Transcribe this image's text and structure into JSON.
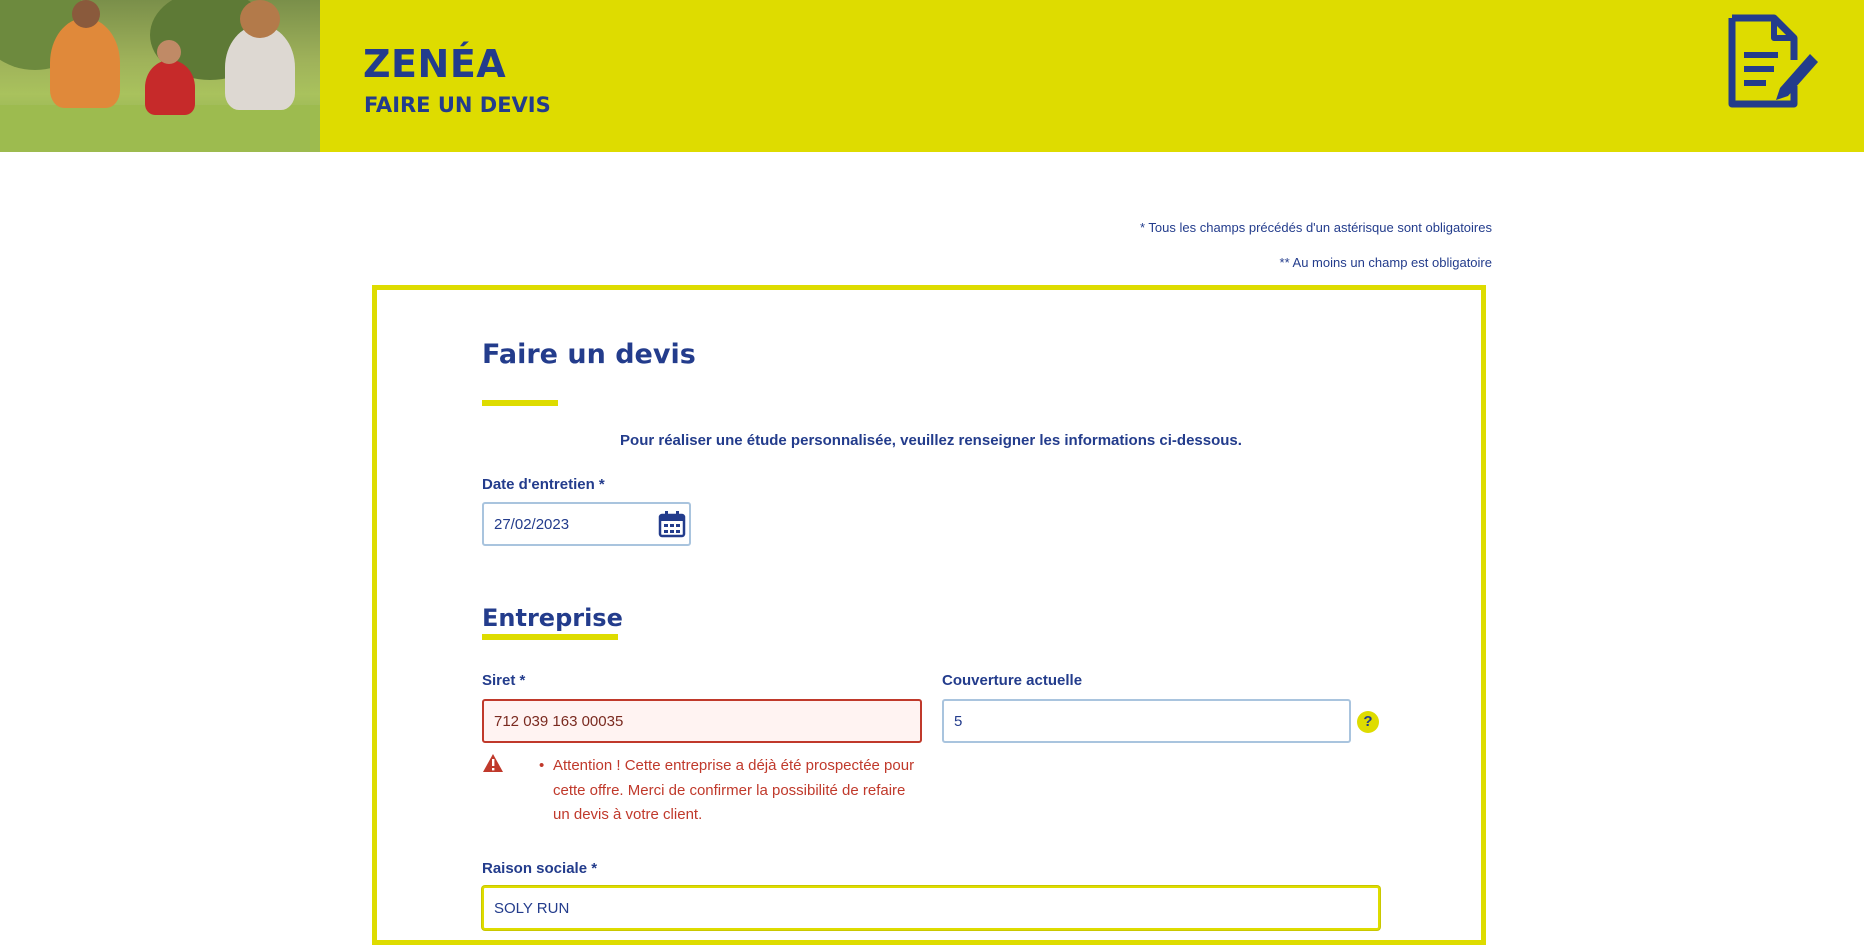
{
  "header": {
    "brand": "ZENÉA",
    "subtitle": "FAIRE UN DEVIS",
    "hero_image": "family-meditating-outdoors-photo",
    "icon": "document-edit-icon",
    "background_color": "#dedc00",
    "text_color": "#233c8c"
  },
  "notes": {
    "required": "* Tous les champs précédés d'un astérisque sont obligatoires",
    "at_least_one": "** Au moins un champ est obligatoire"
  },
  "form": {
    "title": "Faire un devis",
    "intro": "Pour réaliser une étude personnalisée, veuillez renseigner les informations ci-dessous.",
    "date_label": "Date d'entretien *",
    "date_value": "27/02/2023",
    "date_icon": "calendar-icon"
  },
  "entreprise": {
    "section_title": "Entreprise",
    "siret_label": "Siret *",
    "siret_value": "712 039 163 00035",
    "siret_error": "Attention ! Cette entreprise a déjà été prospectée pour cette offre. Merci de confirmer la possibilité de refaire un devis à votre client.",
    "warning_icon": "warning-icon",
    "couverture_label": "Couverture actuelle",
    "couverture_value": "5",
    "help_label": "?",
    "raison_label": "Raison sociale *",
    "raison_value": "SOLY RUN"
  },
  "colors": {
    "accent": "#dedc00",
    "primary": "#233c8c",
    "error": "#c0392b"
  }
}
